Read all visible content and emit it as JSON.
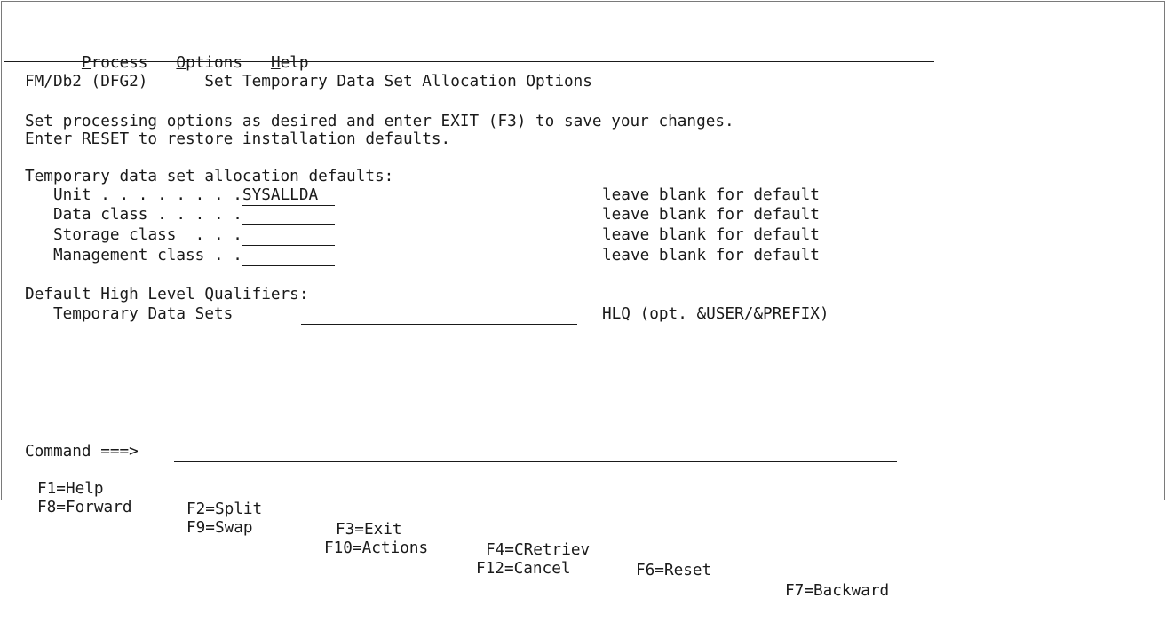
{
  "menu": {
    "items": [
      {
        "key": "P",
        "rest": "rocess"
      },
      {
        "key": "O",
        "rest": "ptions"
      },
      {
        "key": "H",
        "rest": "elp"
      }
    ]
  },
  "header": {
    "product": "FM/Db2 (DFG2)",
    "title": "Set Temporary Data Set Allocation Options"
  },
  "instructions": {
    "line1": "Set processing options as desired and enter EXIT (F3) to save your changes.",
    "line2": "Enter RESET to restore installation defaults."
  },
  "alloc": {
    "heading": "Temporary data set allocation defaults:",
    "unit_label": "Unit . . . . . . . .",
    "unit_value": "SYSALLDA",
    "data_class_label": "Data class . . . . .",
    "data_class_value": "",
    "storage_class_label": "Storage class  . . .",
    "storage_class_value": "",
    "mgmt_class_label": "Management class . .",
    "mgmt_class_value": "",
    "hint": "leave blank for default"
  },
  "hlq": {
    "heading": "Default High Level Qualifiers:",
    "temp_label": "Temporary Data Sets",
    "temp_value": "",
    "temp_hint": "HLQ (opt. &USER/&PREFIX)"
  },
  "command": {
    "label": "Command ===>",
    "value": ""
  },
  "fkeys": {
    "row1": [
      "F1=Help",
      "F2=Split",
      "F3=Exit",
      "F4=CRetriev",
      "F6=Reset",
      "F7=Backward"
    ],
    "row2": [
      "F8=Forward",
      "F9=Swap",
      "F10=Actions",
      "F12=Cancel"
    ]
  }
}
